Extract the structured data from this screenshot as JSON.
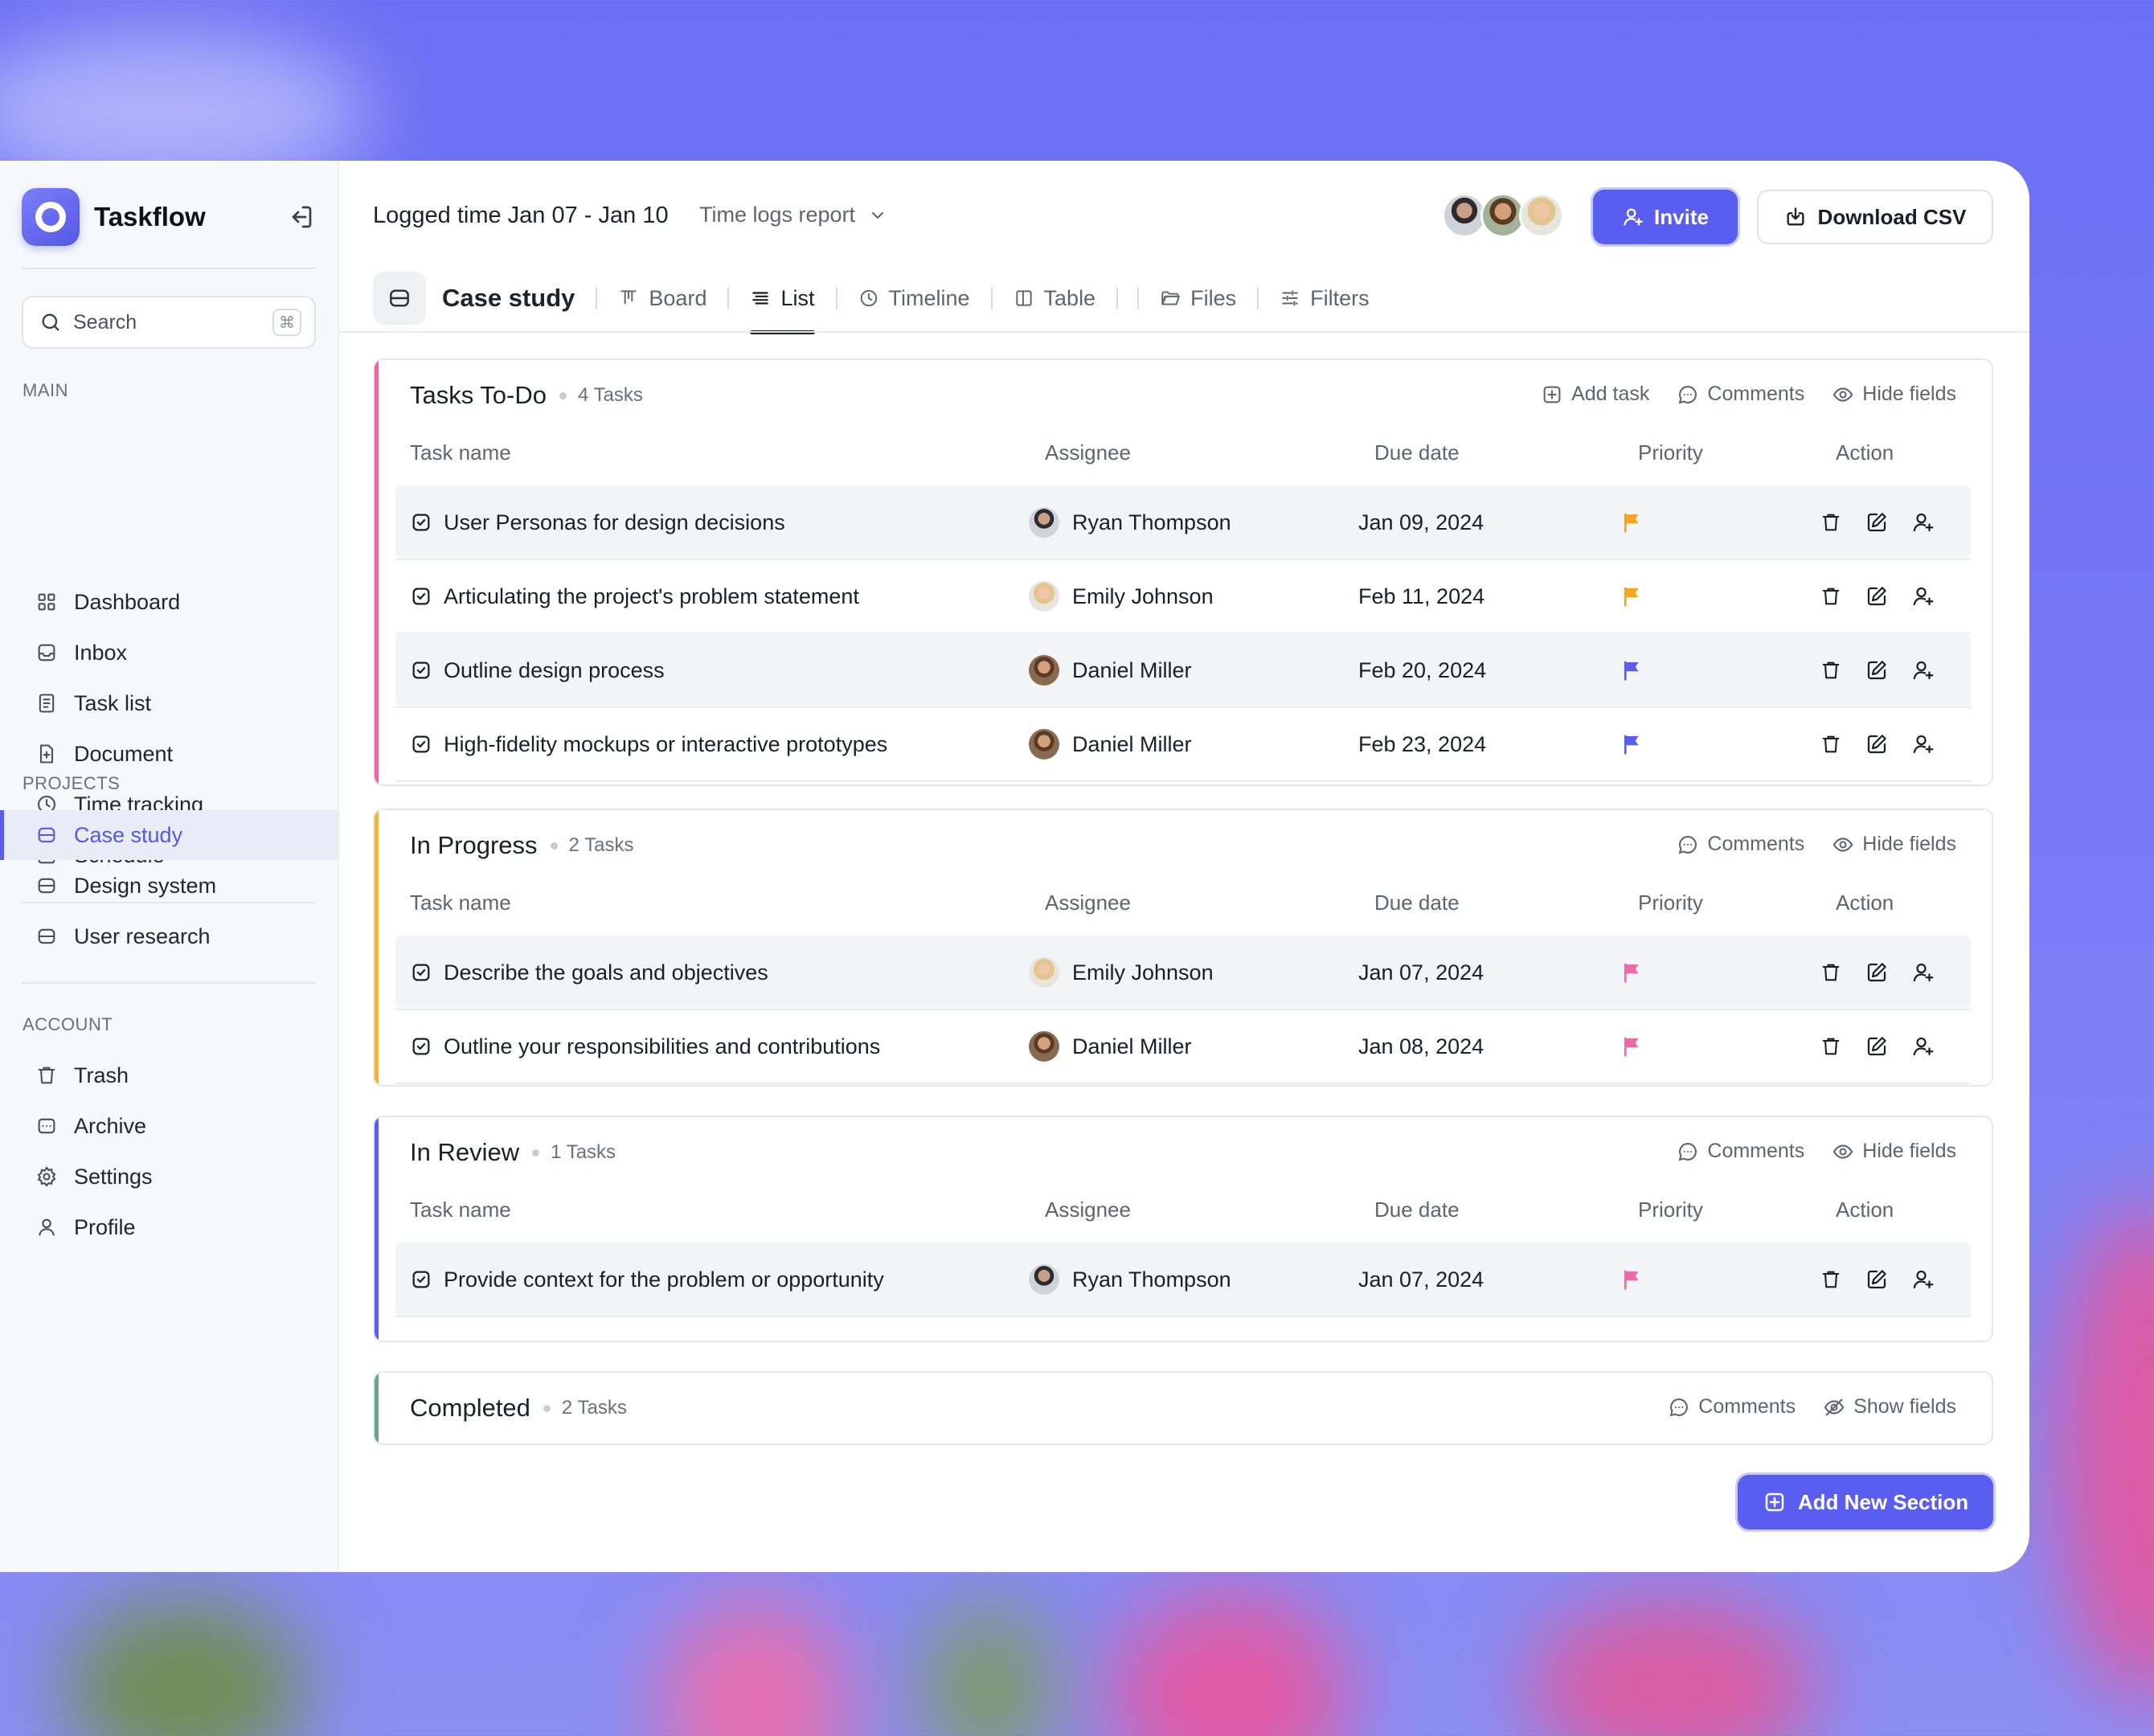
{
  "app": {
    "name": "Taskflow"
  },
  "sidebar": {
    "search_label": "Search",
    "shortcut": "⌘",
    "main_heading": "MAIN",
    "main_items": [
      {
        "label": "Dashboard"
      },
      {
        "label": "Inbox"
      },
      {
        "label": "Task list"
      },
      {
        "label": "Document"
      },
      {
        "label": "Time tracking"
      },
      {
        "label": "Schedule"
      }
    ],
    "projects_heading": "PROJECTS",
    "project_items": [
      {
        "label": "Case study"
      },
      {
        "label": "Design system"
      },
      {
        "label": "User research"
      }
    ],
    "account_heading": "ACCOUNT",
    "account_items": [
      {
        "label": "Trash"
      },
      {
        "label": "Archive"
      },
      {
        "label": "Settings"
      },
      {
        "label": "Profile"
      }
    ]
  },
  "header": {
    "title": "Logged time Jan 07 - Jan 10",
    "report_label": "Time logs report",
    "invite_label": "Invite",
    "csv_label": "Download CSV"
  },
  "tabs": {
    "project": "Case study",
    "items": [
      {
        "label": "Board"
      },
      {
        "label": "List"
      },
      {
        "label": "Timeline"
      },
      {
        "label": "Table"
      },
      {
        "label": "Files"
      },
      {
        "label": "Filters"
      }
    ]
  },
  "columns": {
    "task": "Task name",
    "assignee": "Assignee",
    "due": "Due date",
    "priority": "Priority",
    "action": "Action"
  },
  "groups": [
    {
      "title": "Tasks To-Do",
      "count": "4 Tasks",
      "accent": "#e8679f",
      "add_task": "Add task",
      "comments": "Comments",
      "fields": "Hide fields",
      "rows": [
        {
          "task": "User Personas for design decisions",
          "assignee": "Ryan Thompson",
          "due": "Jan 09, 2024",
          "flag": "#f5a524"
        },
        {
          "task": "Articulating the project's problem statement",
          "assignee": "Emily Johnson",
          "due": "Feb 11, 2024",
          "flag": "#f5a524"
        },
        {
          "task": "Outline design process",
          "assignee": "Daniel Miller",
          "due": "Feb 20, 2024",
          "flag": "#5a5ef0"
        },
        {
          "task": "High-fidelity mockups or interactive prototypes",
          "assignee": "Daniel Miller",
          "due": "Feb 23, 2024",
          "flag": "#5a5ef0"
        }
      ]
    },
    {
      "title": "In Progress",
      "count": "2 Tasks",
      "accent": "#f0b23e",
      "comments": "Comments",
      "fields": "Hide fields",
      "rows": [
        {
          "task": "Describe the goals and objectives",
          "assignee": "Emily Johnson",
          "due": "Jan 07, 2024",
          "flag": "#ec6aa8"
        },
        {
          "task": "Outline your responsibilities and contributions",
          "assignee": "Daniel Miller",
          "due": "Jan 08, 2024",
          "flag": "#ec6aa8"
        }
      ]
    },
    {
      "title": "In Review",
      "count": "1 Tasks",
      "accent": "#5a5ef0",
      "comments": "Comments",
      "fields": "Hide fields",
      "rows": [
        {
          "task": "Provide context for the problem or opportunity",
          "assignee": "Ryan Thompson",
          "due": "Jan 07, 2024",
          "flag": "#ec6aa8"
        }
      ]
    },
    {
      "title": "Completed",
      "count": "2 Tasks",
      "accent": "#6aa386",
      "comments": "Comments",
      "fields": "Show fields",
      "rows": []
    }
  ],
  "add_section_label": "Add New Section",
  "colors": {
    "accent": "#5a5ef0",
    "background": "#6b70f3"
  }
}
